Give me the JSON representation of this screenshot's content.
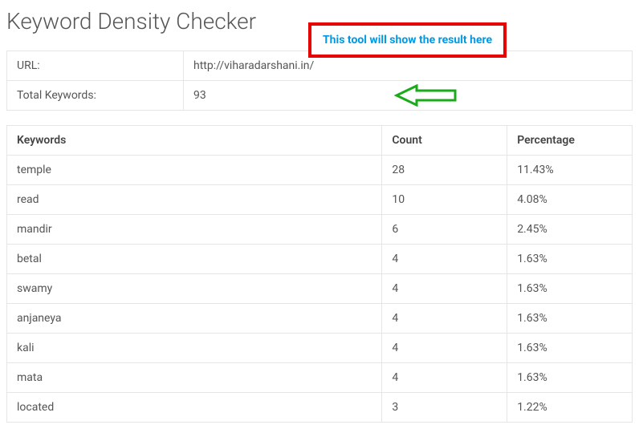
{
  "title": "Keyword Density Checker",
  "annotation": "This tool will show the result here",
  "summary": {
    "url_label": "URL:",
    "url_value": "http://viharadarshani.in/",
    "total_label": "Total Keywords:",
    "total_value": "93"
  },
  "results": {
    "headers": {
      "keyword": "Keywords",
      "count": "Count",
      "percentage": "Percentage"
    },
    "rows": [
      {
        "keyword": "temple",
        "count": "28",
        "percentage": "11.43%"
      },
      {
        "keyword": "read",
        "count": "10",
        "percentage": "4.08%"
      },
      {
        "keyword": "mandir",
        "count": "6",
        "percentage": "2.45%"
      },
      {
        "keyword": "betal",
        "count": "4",
        "percentage": "1.63%"
      },
      {
        "keyword": "swamy",
        "count": "4",
        "percentage": "1.63%"
      },
      {
        "keyword": "anjaneya",
        "count": "4",
        "percentage": "1.63%"
      },
      {
        "keyword": "kali",
        "count": "4",
        "percentage": "1.63%"
      },
      {
        "keyword": "mata",
        "count": "4",
        "percentage": "1.63%"
      },
      {
        "keyword": "located",
        "count": "3",
        "percentage": "1.22%"
      }
    ]
  }
}
